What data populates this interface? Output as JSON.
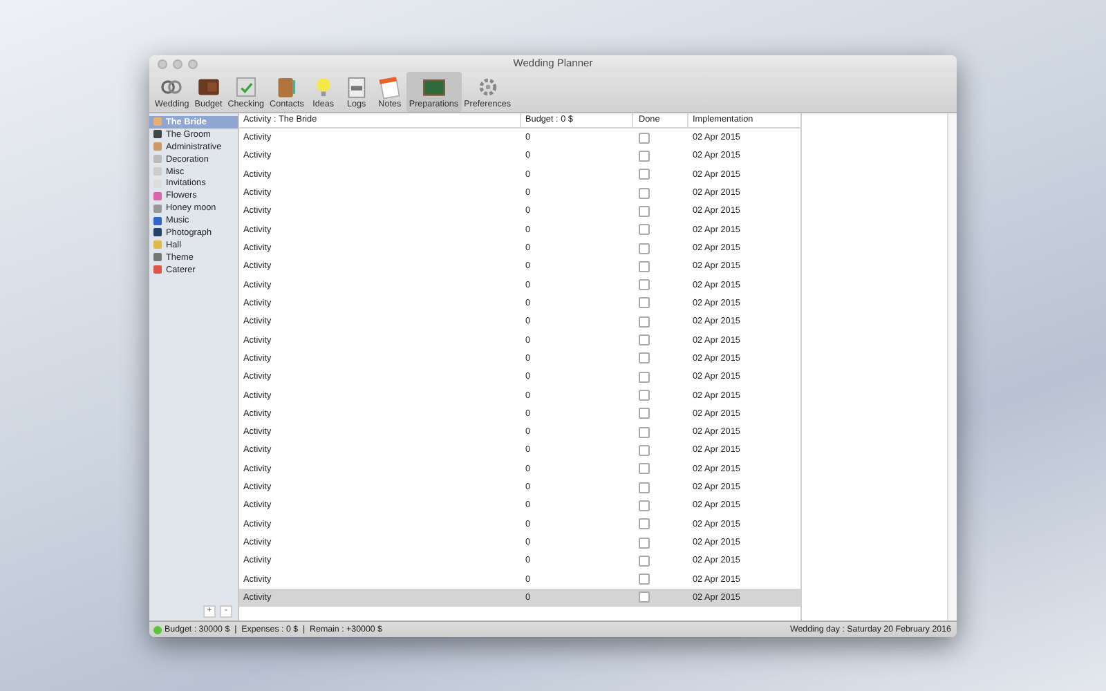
{
  "window": {
    "title": "Wedding Planner"
  },
  "toolbar": [
    {
      "label": "Wedding",
      "selected": false
    },
    {
      "label": "Budget",
      "selected": false
    },
    {
      "label": "Checking",
      "selected": false
    },
    {
      "label": "Contacts",
      "selected": false
    },
    {
      "label": "Ideas",
      "selected": false
    },
    {
      "label": "Logs",
      "selected": false
    },
    {
      "label": "Notes",
      "selected": false
    },
    {
      "label": "Preparations",
      "selected": true
    },
    {
      "label": "Preferences",
      "selected": false
    }
  ],
  "sidebar": {
    "items": [
      {
        "label": "The Bride",
        "selected": true
      },
      {
        "label": "The Groom",
        "selected": false
      },
      {
        "label": "Administrative",
        "selected": false
      },
      {
        "label": "Decoration",
        "selected": false
      },
      {
        "label": "Misc",
        "selected": false
      },
      {
        "label": "Invitations",
        "selected": false
      },
      {
        "label": "Flowers",
        "selected": false
      },
      {
        "label": "Honey moon",
        "selected": false
      },
      {
        "label": "Music",
        "selected": false
      },
      {
        "label": "Photograph",
        "selected": false
      },
      {
        "label": "Hall",
        "selected": false
      },
      {
        "label": "Theme",
        "selected": false
      },
      {
        "label": "Caterer",
        "selected": false
      }
    ],
    "buttons": [
      "+",
      "-"
    ]
  },
  "table": {
    "columns": [
      "Activity : The Bride",
      "Budget : 0 $",
      "Done",
      "Implementation"
    ],
    "rows": [
      {
        "activity": "Activity",
        "budget": "0",
        "done": false,
        "implementation": "02 Apr 2015",
        "selected": false
      },
      {
        "activity": "Activity",
        "budget": "0",
        "done": false,
        "implementation": "02 Apr 2015",
        "selected": false
      },
      {
        "activity": "Activity",
        "budget": "0",
        "done": false,
        "implementation": "02 Apr 2015",
        "selected": false
      },
      {
        "activity": "Activity",
        "budget": "0",
        "done": false,
        "implementation": "02 Apr 2015",
        "selected": false
      },
      {
        "activity": "Activity",
        "budget": "0",
        "done": false,
        "implementation": "02 Apr 2015",
        "selected": false
      },
      {
        "activity": "Activity",
        "budget": "0",
        "done": false,
        "implementation": "02 Apr 2015",
        "selected": false
      },
      {
        "activity": "Activity",
        "budget": "0",
        "done": false,
        "implementation": "02 Apr 2015",
        "selected": false
      },
      {
        "activity": "Activity",
        "budget": "0",
        "done": false,
        "implementation": "02 Apr 2015",
        "selected": false
      },
      {
        "activity": "Activity",
        "budget": "0",
        "done": false,
        "implementation": "02 Apr 2015",
        "selected": false
      },
      {
        "activity": "Activity",
        "budget": "0",
        "done": false,
        "implementation": "02 Apr 2015",
        "selected": false
      },
      {
        "activity": "Activity",
        "budget": "0",
        "done": false,
        "implementation": "02 Apr 2015",
        "selected": false
      },
      {
        "activity": "Activity",
        "budget": "0",
        "done": false,
        "implementation": "02 Apr 2015",
        "selected": false
      },
      {
        "activity": "Activity",
        "budget": "0",
        "done": false,
        "implementation": "02 Apr 2015",
        "selected": false
      },
      {
        "activity": "Activity",
        "budget": "0",
        "done": false,
        "implementation": "02 Apr 2015",
        "selected": false
      },
      {
        "activity": "Activity",
        "budget": "0",
        "done": false,
        "implementation": "02 Apr 2015",
        "selected": false
      },
      {
        "activity": "Activity",
        "budget": "0",
        "done": false,
        "implementation": "02 Apr 2015",
        "selected": false
      },
      {
        "activity": "Activity",
        "budget": "0",
        "done": false,
        "implementation": "02 Apr 2015",
        "selected": false
      },
      {
        "activity": "Activity",
        "budget": "0",
        "done": false,
        "implementation": "02 Apr 2015",
        "selected": false
      },
      {
        "activity": "Activity",
        "budget": "0",
        "done": false,
        "implementation": "02 Apr 2015",
        "selected": false
      },
      {
        "activity": "Activity",
        "budget": "0",
        "done": false,
        "implementation": "02 Apr 2015",
        "selected": false
      },
      {
        "activity": "Activity",
        "budget": "0",
        "done": false,
        "implementation": "02 Apr 2015",
        "selected": false
      },
      {
        "activity": "Activity",
        "budget": "0",
        "done": false,
        "implementation": "02 Apr 2015",
        "selected": false
      },
      {
        "activity": "Activity",
        "budget": "0",
        "done": false,
        "implementation": "02 Apr 2015",
        "selected": false
      },
      {
        "activity": "Activity",
        "budget": "0",
        "done": false,
        "implementation": "02 Apr 2015",
        "selected": false
      },
      {
        "activity": "Activity",
        "budget": "0",
        "done": false,
        "implementation": "02 Apr 2015",
        "selected": false
      },
      {
        "activity": "Activity",
        "budget": "0",
        "done": false,
        "implementation": "02 Apr 2015",
        "selected": true
      }
    ]
  },
  "status_bar": {
    "summary": "Budget : 30000 $  |  Expenses : 0 $  |  Remain : +30000 $",
    "wedding_day": "Wedding day : Saturday 20 February 2016"
  }
}
